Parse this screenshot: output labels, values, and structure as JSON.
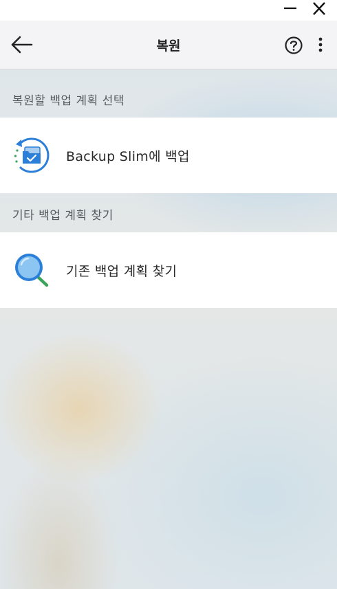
{
  "window": {
    "minimize_icon": "minimize-icon",
    "close_icon": "close-icon"
  },
  "header": {
    "title": "복원",
    "back_icon": "arrow-left-icon",
    "help_icon": "question-circle-icon",
    "more_icon": "more-vertical-icon"
  },
  "sections": [
    {
      "label": "복원할 백업 계획 선택",
      "items": [
        {
          "label": "Backup Slim에 백업",
          "icon": "backup-folder-icon"
        }
      ]
    },
    {
      "label": "기타 백업 계획 찾기",
      "items": [
        {
          "label": "기존 백업 계획 찾기",
          "icon": "search-magnifier-icon"
        }
      ]
    }
  ],
  "colors": {
    "accent_blue": "#2b7fd9",
    "accent_green": "#3aa35a",
    "header_bg": "#f4f4f7",
    "row_bg": "#ffffff"
  }
}
